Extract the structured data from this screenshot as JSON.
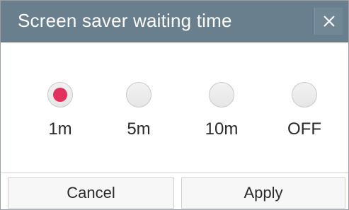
{
  "dialog": {
    "title": "Screen saver waiting time",
    "close_icon": "close-icon"
  },
  "options": [
    {
      "label": "1m",
      "checked": true
    },
    {
      "label": "5m",
      "checked": false
    },
    {
      "label": "10m",
      "checked": false
    },
    {
      "label": "OFF",
      "checked": false
    }
  ],
  "buttons": {
    "cancel_label": "Cancel",
    "apply_label": "Apply"
  },
  "colors": {
    "titlebar": "#6a7f8e",
    "selected_radio": "#e3305c"
  }
}
